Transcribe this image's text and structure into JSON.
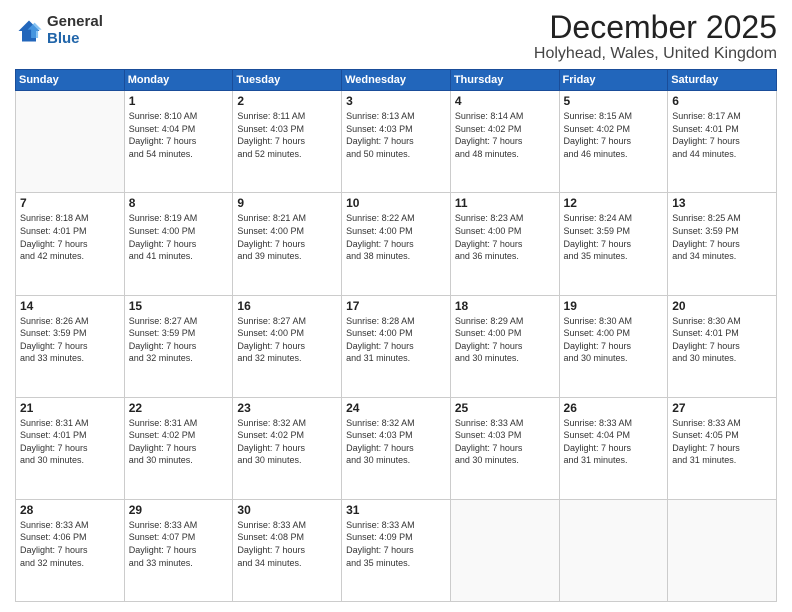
{
  "logo": {
    "general": "General",
    "blue": "Blue"
  },
  "title": "December 2025",
  "subtitle": "Holyhead, Wales, United Kingdom",
  "days_of_week": [
    "Sunday",
    "Monday",
    "Tuesday",
    "Wednesday",
    "Thursday",
    "Friday",
    "Saturday"
  ],
  "weeks": [
    [
      {
        "day": "",
        "info": ""
      },
      {
        "day": "1",
        "info": "Sunrise: 8:10 AM\nSunset: 4:04 PM\nDaylight: 7 hours\nand 54 minutes."
      },
      {
        "day": "2",
        "info": "Sunrise: 8:11 AM\nSunset: 4:03 PM\nDaylight: 7 hours\nand 52 minutes."
      },
      {
        "day": "3",
        "info": "Sunrise: 8:13 AM\nSunset: 4:03 PM\nDaylight: 7 hours\nand 50 minutes."
      },
      {
        "day": "4",
        "info": "Sunrise: 8:14 AM\nSunset: 4:02 PM\nDaylight: 7 hours\nand 48 minutes."
      },
      {
        "day": "5",
        "info": "Sunrise: 8:15 AM\nSunset: 4:02 PM\nDaylight: 7 hours\nand 46 minutes."
      },
      {
        "day": "6",
        "info": "Sunrise: 8:17 AM\nSunset: 4:01 PM\nDaylight: 7 hours\nand 44 minutes."
      }
    ],
    [
      {
        "day": "7",
        "info": "Sunrise: 8:18 AM\nSunset: 4:01 PM\nDaylight: 7 hours\nand 42 minutes."
      },
      {
        "day": "8",
        "info": "Sunrise: 8:19 AM\nSunset: 4:00 PM\nDaylight: 7 hours\nand 41 minutes."
      },
      {
        "day": "9",
        "info": "Sunrise: 8:21 AM\nSunset: 4:00 PM\nDaylight: 7 hours\nand 39 minutes."
      },
      {
        "day": "10",
        "info": "Sunrise: 8:22 AM\nSunset: 4:00 PM\nDaylight: 7 hours\nand 38 minutes."
      },
      {
        "day": "11",
        "info": "Sunrise: 8:23 AM\nSunset: 4:00 PM\nDaylight: 7 hours\nand 36 minutes."
      },
      {
        "day": "12",
        "info": "Sunrise: 8:24 AM\nSunset: 3:59 PM\nDaylight: 7 hours\nand 35 minutes."
      },
      {
        "day": "13",
        "info": "Sunrise: 8:25 AM\nSunset: 3:59 PM\nDaylight: 7 hours\nand 34 minutes."
      }
    ],
    [
      {
        "day": "14",
        "info": "Sunrise: 8:26 AM\nSunset: 3:59 PM\nDaylight: 7 hours\nand 33 minutes."
      },
      {
        "day": "15",
        "info": "Sunrise: 8:27 AM\nSunset: 3:59 PM\nDaylight: 7 hours\nand 32 minutes."
      },
      {
        "day": "16",
        "info": "Sunrise: 8:27 AM\nSunset: 4:00 PM\nDaylight: 7 hours\nand 32 minutes."
      },
      {
        "day": "17",
        "info": "Sunrise: 8:28 AM\nSunset: 4:00 PM\nDaylight: 7 hours\nand 31 minutes."
      },
      {
        "day": "18",
        "info": "Sunrise: 8:29 AM\nSunset: 4:00 PM\nDaylight: 7 hours\nand 30 minutes."
      },
      {
        "day": "19",
        "info": "Sunrise: 8:30 AM\nSunset: 4:00 PM\nDaylight: 7 hours\nand 30 minutes."
      },
      {
        "day": "20",
        "info": "Sunrise: 8:30 AM\nSunset: 4:01 PM\nDaylight: 7 hours\nand 30 minutes."
      }
    ],
    [
      {
        "day": "21",
        "info": "Sunrise: 8:31 AM\nSunset: 4:01 PM\nDaylight: 7 hours\nand 30 minutes."
      },
      {
        "day": "22",
        "info": "Sunrise: 8:31 AM\nSunset: 4:02 PM\nDaylight: 7 hours\nand 30 minutes."
      },
      {
        "day": "23",
        "info": "Sunrise: 8:32 AM\nSunset: 4:02 PM\nDaylight: 7 hours\nand 30 minutes."
      },
      {
        "day": "24",
        "info": "Sunrise: 8:32 AM\nSunset: 4:03 PM\nDaylight: 7 hours\nand 30 minutes."
      },
      {
        "day": "25",
        "info": "Sunrise: 8:33 AM\nSunset: 4:03 PM\nDaylight: 7 hours\nand 30 minutes."
      },
      {
        "day": "26",
        "info": "Sunrise: 8:33 AM\nSunset: 4:04 PM\nDaylight: 7 hours\nand 31 minutes."
      },
      {
        "day": "27",
        "info": "Sunrise: 8:33 AM\nSunset: 4:05 PM\nDaylight: 7 hours\nand 31 minutes."
      }
    ],
    [
      {
        "day": "28",
        "info": "Sunrise: 8:33 AM\nSunset: 4:06 PM\nDaylight: 7 hours\nand 32 minutes."
      },
      {
        "day": "29",
        "info": "Sunrise: 8:33 AM\nSunset: 4:07 PM\nDaylight: 7 hours\nand 33 minutes."
      },
      {
        "day": "30",
        "info": "Sunrise: 8:33 AM\nSunset: 4:08 PM\nDaylight: 7 hours\nand 34 minutes."
      },
      {
        "day": "31",
        "info": "Sunrise: 8:33 AM\nSunset: 4:09 PM\nDaylight: 7 hours\nand 35 minutes."
      },
      {
        "day": "",
        "info": ""
      },
      {
        "day": "",
        "info": ""
      },
      {
        "day": "",
        "info": ""
      }
    ]
  ]
}
